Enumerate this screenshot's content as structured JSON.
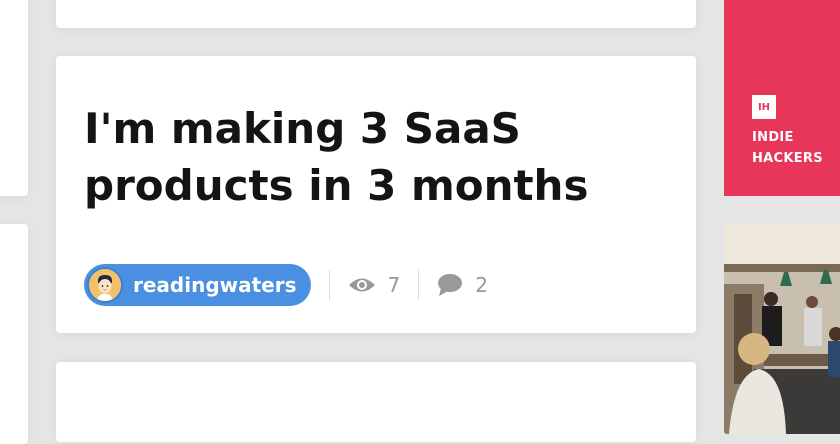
{
  "post": {
    "title": "I'm making 3 SaaS products in 3 months",
    "author": "readingwaters",
    "views": "7",
    "comments": "2"
  },
  "sidebar": {
    "logo_text": "IH",
    "brand_line1": "INDIE",
    "brand_line2": "HACKERS"
  },
  "icons": {
    "views": "eye-icon",
    "comments": "comment-icon",
    "avatar": "avatar"
  },
  "colors": {
    "background": "#e5e5e5",
    "card": "#ffffff",
    "author_pill": "#4a90e2",
    "brand": "#e8365a",
    "meta_text": "#999999",
    "title_text": "#141414"
  }
}
